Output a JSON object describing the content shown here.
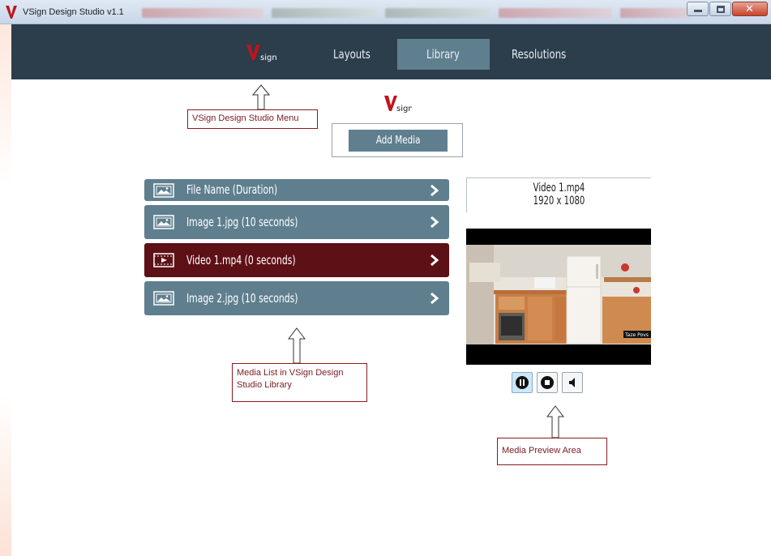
{
  "window": {
    "title": "VSign Design Studio v1.1",
    "buttons": [
      "minimize",
      "maximize",
      "close"
    ]
  },
  "nav": {
    "brand": "sign",
    "items": [
      {
        "label": "Layouts",
        "active": false
      },
      {
        "label": "Library",
        "active": true
      },
      {
        "label": "Resolutions",
        "active": false
      }
    ]
  },
  "toolbar": {
    "brand": "sign",
    "add_media_label": "Add Media"
  },
  "media_list": {
    "header": {
      "label": "File Name (Duration)",
      "icon": "image-icon"
    },
    "items": [
      {
        "label": "Image 1.jpg (10 seconds)",
        "icon": "image-icon",
        "selected": false
      },
      {
        "label": "Video 1.mp4 (0 seconds)",
        "icon": "video-icon",
        "selected": true
      },
      {
        "label": "Image 2.jpg (10 seconds)",
        "icon": "image-icon",
        "selected": false
      }
    ]
  },
  "preview": {
    "file_name": "Video 1.mp4",
    "resolution": "1920 x 1080",
    "watermark": "Taze Povs",
    "controls": [
      "pause",
      "stop",
      "mute"
    ]
  },
  "annotations": {
    "menu": "VSign Design Studio Menu",
    "list_line1": "Media List in VSign Design",
    "list_line2": "Studio Library",
    "preview": "Media Preview Area"
  },
  "colors": {
    "nav_bg": "#2c3e4c",
    "accent": "#5f7f8f",
    "selected_row": "#5e1017",
    "brand_red": "#c0141c",
    "callout_border": "#8b1a1f"
  }
}
